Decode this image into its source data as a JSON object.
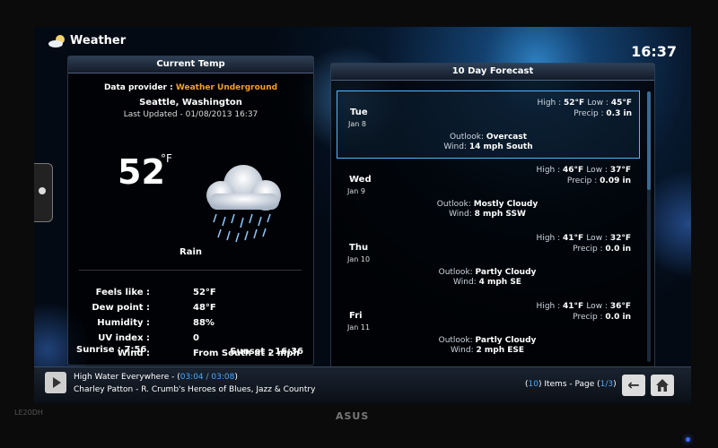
{
  "app": {
    "title": "Weather",
    "clock": "16:37"
  },
  "current": {
    "header": "Current Temp",
    "provider_label": "Data provider : ",
    "provider_name": "Weather Underground",
    "city": "Seattle, Washington",
    "last_updated": "Last Updated - 01/08/2013 16:37",
    "temperature": "52",
    "unit": "°F",
    "condition": "Rain",
    "icon": "rain-cloud-icon",
    "details": [
      {
        "label": "Feels like :",
        "value": "52°F"
      },
      {
        "label": "Dew point :",
        "value": "48°F"
      },
      {
        "label": "Humidity :",
        "value": "88%"
      },
      {
        "label": "UV index :",
        "value": "0"
      },
      {
        "label": "Wind :",
        "value": "From South at 2 mph"
      }
    ],
    "sunrise": "Sunrise : 7:56",
    "sunset": "Sunset : 16:36"
  },
  "forecast": {
    "header": "10 Day Forecast",
    "days": [
      {
        "day": "Tue",
        "date": "Jan 8",
        "high": "52°F",
        "low": "45°F",
        "precip": "0.3 in",
        "outlook": "Overcast",
        "wind": "14 mph South"
      },
      {
        "day": "Wed",
        "date": "Jan 9",
        "high": "46°F",
        "low": "37°F",
        "precip": "0.09 in",
        "outlook": "Mostly Cloudy",
        "wind": "8 mph SSW"
      },
      {
        "day": "Thu",
        "date": "Jan 10",
        "high": "41°F",
        "low": "32°F",
        "precip": "0.0 in",
        "outlook": "Partly Cloudy",
        "wind": "4 mph SE"
      },
      {
        "day": "Fri",
        "date": "Jan 11",
        "high": "41°F",
        "low": "36°F",
        "precip": "0.0 in",
        "outlook": "Partly Cloudy",
        "wind": "2 mph ESE"
      }
    ],
    "labels": {
      "high": "High : ",
      "low": "Low : ",
      "precip": "Precip : ",
      "outlook": "Outlook: ",
      "wind": "Wind: "
    }
  },
  "now_playing": {
    "title": "High Water Everywhere - (",
    "time": "03:04 / 03:08",
    "title_end": ")",
    "artist": "Charley Patton - R. Crumb's Heroes of Blues, Jazz & Country"
  },
  "pager": {
    "open": "(",
    "items": "10",
    "mid": ") Items - Page (",
    "page": "1/3",
    "close": ")"
  },
  "monitor": {
    "brand": "ASUS",
    "model": "LE20DH"
  },
  "colors": {
    "accent": "#49a8ff",
    "provider": "#f2a12a",
    "selection": "#55b7ff"
  }
}
